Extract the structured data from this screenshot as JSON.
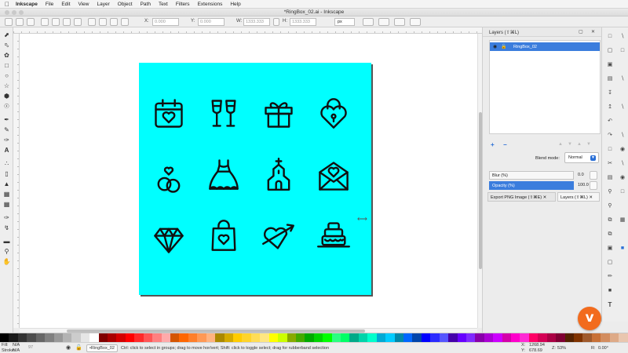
{
  "menubar": {
    "app_name": "Inkscape",
    "items": [
      "File",
      "Edit",
      "View",
      "Layer",
      "Object",
      "Path",
      "Text",
      "Filters",
      "Extensions",
      "Help"
    ]
  },
  "window": {
    "title": "*RingBox_02.ai - Inkscape"
  },
  "tool_controls": {
    "x_label": "X:",
    "x_value": "0.000",
    "y_label": "Y:",
    "y_value": "0.000",
    "w_label": "W:",
    "w_value": "1333.333",
    "h_label": "H:",
    "h_value": "1333.333",
    "unit": "px"
  },
  "canvas": {
    "artboard_color": "#00ffff",
    "icons": [
      "calendar-heart-icon",
      "champagne-glasses-icon",
      "gift-box-icon",
      "heart-padlock-icon",
      "rings-icon",
      "wedding-dress-icon",
      "chapel-icon",
      "love-letter-icon",
      "diamond-icon",
      "shopping-bag-heart-icon",
      "heart-arrow-icon",
      "wedding-cake-icon"
    ]
  },
  "layers_panel": {
    "title": "Layers (⇧⌘L)",
    "layer_name": "RingBox_02",
    "add_label": "+",
    "remove_label": "−",
    "blend_mode_label": "Blend mode:",
    "blend_mode_value": "Normal",
    "blur_label": "Blur (%)",
    "blur_value": "0.0",
    "opacity_label": "Opacity (%)",
    "opacity_value": "100.0",
    "tabs": [
      "Export PNG Image (⇧⌘E)",
      "Layers (⇧⌘L)"
    ]
  },
  "statusbar": {
    "fill_label": "Fill:",
    "fill_value": "N/A",
    "stroke_label": "Stroke:",
    "stroke_value": "N/A",
    "opacity_value": "97",
    "layer_select": "•RingBox_02",
    "message": "Ctrl: click to select in groups; drag to move hor/vert; Shift: click to toggle select; drag for rubberband selection",
    "x_label": "X:",
    "x_value": "1268.94",
    "y_label": "Y:",
    "y_value": "678.69",
    "zoom_label": "Z:",
    "zoom_value": "53%",
    "rotation_label": "R:",
    "rotation_value": "0.00°"
  },
  "palette": [
    "#000000",
    "#1a1a1a",
    "#333333",
    "#4d4d4d",
    "#666666",
    "#808080",
    "#999999",
    "#b3b3b3",
    "#cccccc",
    "#e6e6e6",
    "#ffffff",
    "#800000",
    "#aa0000",
    "#d40000",
    "#ff0000",
    "#ff2a2a",
    "#ff5555",
    "#ff8080",
    "#ffaaaa",
    "#d45500",
    "#ff6600",
    "#ff7f2a",
    "#ff9955",
    "#ffb380",
    "#aa8800",
    "#d4aa00",
    "#ffcc00",
    "#ffd42a",
    "#ffdd55",
    "#ffe680",
    "#ffff00",
    "#ccff00",
    "#88aa00",
    "#44aa00",
    "#00aa00",
    "#00d400",
    "#00ff00",
    "#2aff80",
    "#00ff66",
    "#00aa88",
    "#00d4aa",
    "#00ffcc",
    "#00aad4",
    "#00ccff",
    "#0088aa",
    "#0066ff",
    "#0044aa",
    "#0000ff",
    "#2a2aff",
    "#5555ff",
    "#4400aa",
    "#6600ff",
    "#7f2aff",
    "#8800aa",
    "#aa00d4",
    "#cc00ff",
    "#d400aa",
    "#ff00cc",
    "#ff2ad4",
    "#ff0066",
    "#d40055",
    "#aa0044",
    "#800033",
    "#552200",
    "#803300",
    "#a05a2c",
    "#c87137",
    "#d38d5f",
    "#deaa87",
    "#e9c6af"
  ],
  "logo_text": "v"
}
